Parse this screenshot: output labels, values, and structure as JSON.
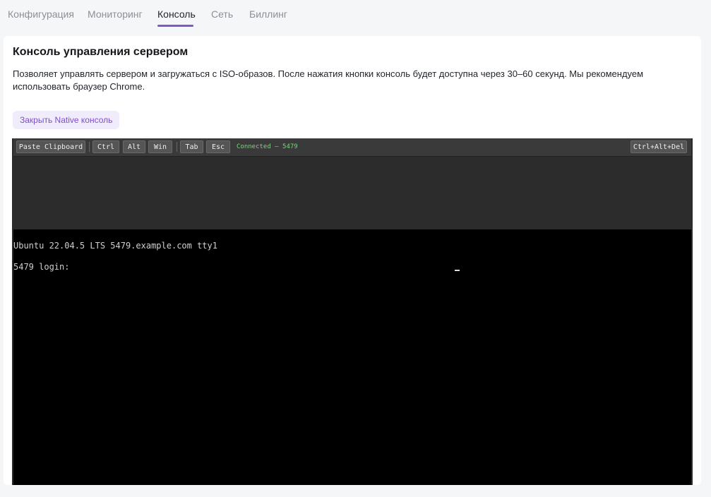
{
  "tabs": [
    {
      "label": "Конфигурация",
      "active": false
    },
    {
      "label": "Мониторинг",
      "active": false
    },
    {
      "label": "Консоль",
      "active": true
    },
    {
      "label": "Сеть",
      "active": false
    },
    {
      "label": "Биллинг",
      "active": false
    }
  ],
  "colors": {
    "accent": "#7c5cc4",
    "status_ok": "#6fdc6f"
  },
  "card": {
    "title": "Консоль управления сервером",
    "description": "Позволяет управлять сервером и загружаться с ISO-образов. После нажатия кнопки консоль будет доступна через 30–60 секунд. Мы рекомендуем использовать браузер Chrome.",
    "close_button": "Закрыть Native консоль"
  },
  "console": {
    "toolbar": {
      "paste": "Paste Clipboard",
      "ctrl": "Ctrl",
      "alt": "Alt",
      "win": "Win",
      "tab": "Tab",
      "esc": "Esc",
      "status": "Connected — 5479",
      "cad": "Ctrl+Alt+Del"
    },
    "screen": {
      "line1": "Ubuntu 22.04.5 LTS 5479.example.com tty1",
      "line2": "5479 login:"
    }
  }
}
